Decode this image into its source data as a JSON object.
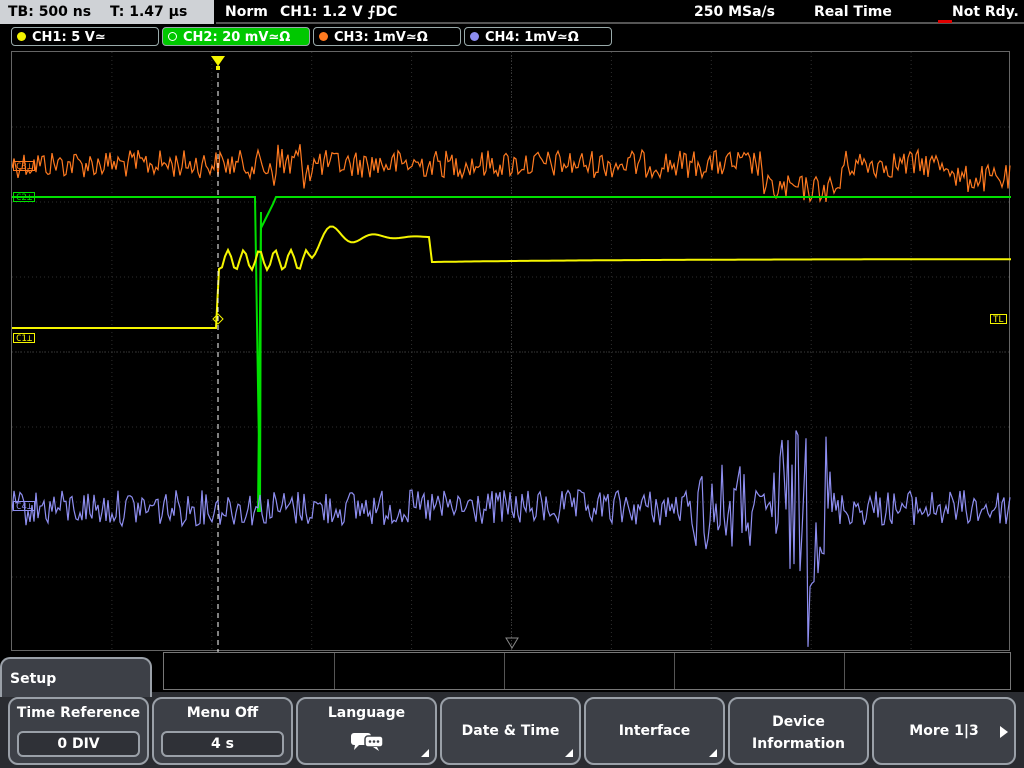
{
  "topbar": {
    "timebase": "TB: 500 ns",
    "trigger_time": "T: 1.47 µs",
    "mode": "Norm",
    "trigger": "CH1: 1.2 V ⨍DC",
    "sample_rate": "250 MSa/s",
    "acquisition": "Real Time",
    "status": "Not Rdy."
  },
  "channels": [
    {
      "label": "CH1: 5 V≃",
      "color": "#f5f500"
    },
    {
      "label": "CH2: 20 mV≃Ω",
      "color": "#00e000"
    },
    {
      "label": "CH3: 1mV≃Ω",
      "color": "#ff7a20"
    },
    {
      "label": "CH4: 1mV≃Ω",
      "color": "#8e8ef0"
    }
  ],
  "markers": {
    "c1": "C1⊥",
    "c2": "C2⊥",
    "c3": "C3⊥",
    "c4": "C4⊥",
    "trigger_level": "TL"
  },
  "menu": {
    "title": "Setup",
    "softkeys": [
      {
        "label": "Time Reference",
        "value": "0 DIV"
      },
      {
        "label": "Menu Off",
        "value": "4 s"
      },
      {
        "label": "Language"
      },
      {
        "label": "Date & Time"
      },
      {
        "label": "Interface"
      },
      {
        "label_line1": "Device",
        "label_line2": "Information"
      },
      {
        "label": "More 1|3"
      }
    ]
  }
}
